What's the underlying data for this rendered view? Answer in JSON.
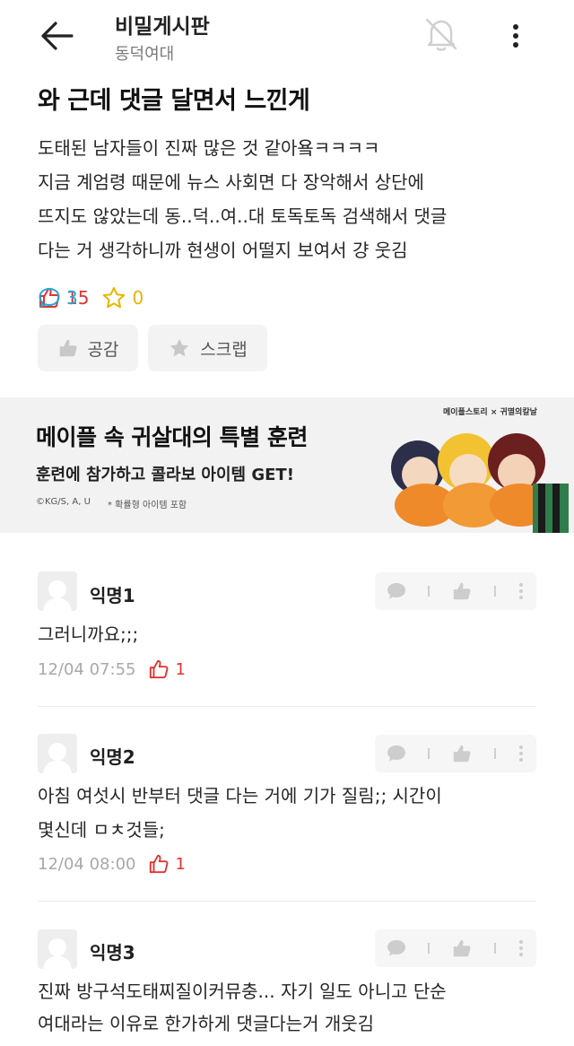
{
  "header": {
    "board_title": "비밀게시판",
    "board_subtitle": "동덕여대"
  },
  "post": {
    "title": "와 근데 댓글 달면서 느낀게",
    "body_lines": [
      "도태된 남자들이 진짜 많은 것 같아욬ㅋㅋㅋㅋ",
      "지금 계엄령 때문에 뉴스 사회면 다 장악해서 상단에",
      "뜨지도 않았는데 동..덕..여..대 토독토독 검색해서 댓글",
      "다는 거 생각하니까 현생이 어떨지 보여서 걍 웃김"
    ],
    "likes": "15",
    "comments": "3",
    "scraps": "0",
    "like_button": "공감",
    "scrap_button": "스크랩"
  },
  "ad": {
    "title": "메이플 속 귀살대의 특별 훈련",
    "subtitle": "훈련에 참가하고 콜라보 아이템 GET!",
    "copyright": "©KG/S, A, U",
    "note": "* 확률형 아이템 포함",
    "logo_text": "메이플스토리 × 귀멸의칼날"
  },
  "comments": [
    {
      "nick": "익명1",
      "lines": [
        "그러니까요;;;"
      ],
      "time": "12/04 07:55",
      "likes": "1"
    },
    {
      "nick": "익명2",
      "lines": [
        "아침 여섯시 반부터 댓글 다는 거에 기가 질림;; 시간이",
        "몇신데 ㅁㅊ것들;"
      ],
      "time": "12/04 08:00",
      "likes": "1"
    },
    {
      "nick": "익명3",
      "lines": [
        "진짜 방구석도태찌질이커뮤충... 자기 일도 아니고 단순",
        "여대라는 이유로 한가하게 댓글다는거 개웃김"
      ]
    }
  ],
  "colors": {
    "like": "#e0332f",
    "comment": "#20a8d8",
    "scrap": "#e8b500",
    "muted": "#a8a8a8"
  },
  "icons": [
    "back-arrow-icon",
    "bell-off-icon",
    "more-vertical-icon",
    "thumbs-up-icon",
    "speech-bubble-icon",
    "star-icon"
  ]
}
